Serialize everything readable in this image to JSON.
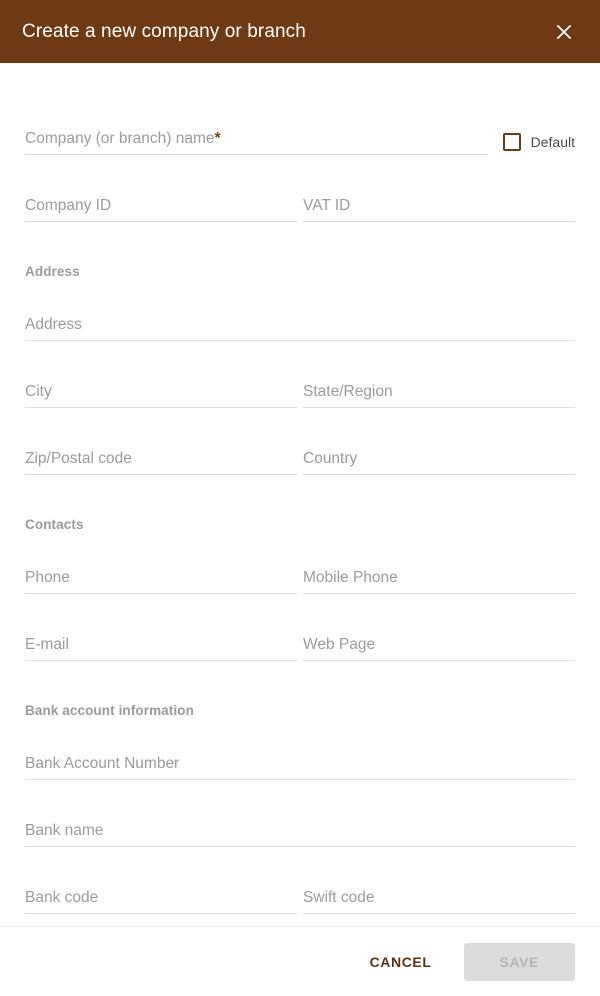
{
  "dialog": {
    "title": "Create a new company or branch",
    "close_icon": "close-icon",
    "accent_color": "#6d3a14",
    "header_text_color": "#ffffff"
  },
  "form": {
    "company_name": {
      "placeholder": "Company (or branch) name",
      "required_marker": "*"
    },
    "default_checkbox": {
      "label": "Default",
      "checked": false
    },
    "company_id": {
      "placeholder": "Company ID"
    },
    "vat_id": {
      "placeholder": "VAT ID"
    },
    "sections": {
      "address": "Address",
      "contacts": "Contacts",
      "bank": "Bank account information"
    },
    "address": {
      "placeholder": "Address"
    },
    "city": {
      "placeholder": "City"
    },
    "state_region": {
      "placeholder": "State/Region"
    },
    "zip_postal_code": {
      "placeholder": "Zip/Postal code"
    },
    "country": {
      "placeholder": "Country"
    },
    "phone": {
      "placeholder": "Phone"
    },
    "mobile_phone": {
      "placeholder": "Mobile Phone"
    },
    "email": {
      "placeholder": "E-mail"
    },
    "web_page": {
      "placeholder": "Web Page"
    },
    "bank_account_number": {
      "placeholder": "Bank Account Number"
    },
    "bank_name": {
      "placeholder": "Bank name"
    },
    "bank_code": {
      "placeholder": "Bank code"
    },
    "swift_code": {
      "placeholder": "Swift code"
    }
  },
  "footer": {
    "cancel_label": "CANCEL",
    "save_label": "SAVE",
    "save_disabled": true
  }
}
